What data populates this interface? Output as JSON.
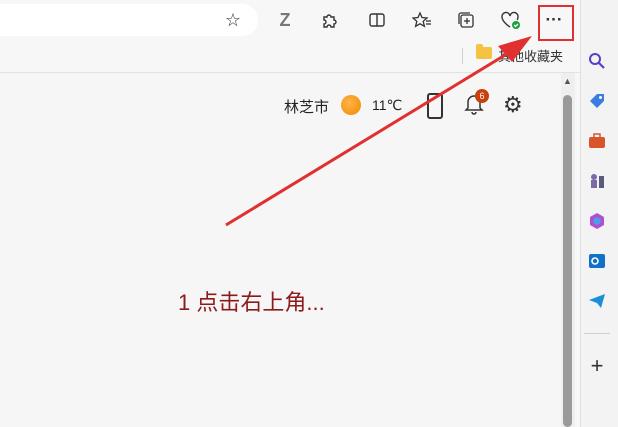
{
  "toolbar": {
    "icons": {
      "favorite": "star-icon",
      "z": "Z",
      "extensions": "puzzle-icon",
      "split": "split-screen-icon",
      "favorites": "favorites-icon",
      "collections": "collections-icon",
      "health": "browser-essentials-icon",
      "more": "···",
      "sidebar_toggle": "sidebar-toggle-icon"
    }
  },
  "favorites_bar": {
    "other_folder": "其他收藏夹"
  },
  "weather": {
    "city": "林芝市",
    "temp": "11℃"
  },
  "notifications": {
    "count": "6"
  },
  "annotation": {
    "text": "1 点击右上角..."
  },
  "colors": {
    "highlight": "#e03030",
    "arrow": "#e03030",
    "annotation_text": "#8b1a1a"
  },
  "sidebar": {
    "add_label": "+"
  }
}
